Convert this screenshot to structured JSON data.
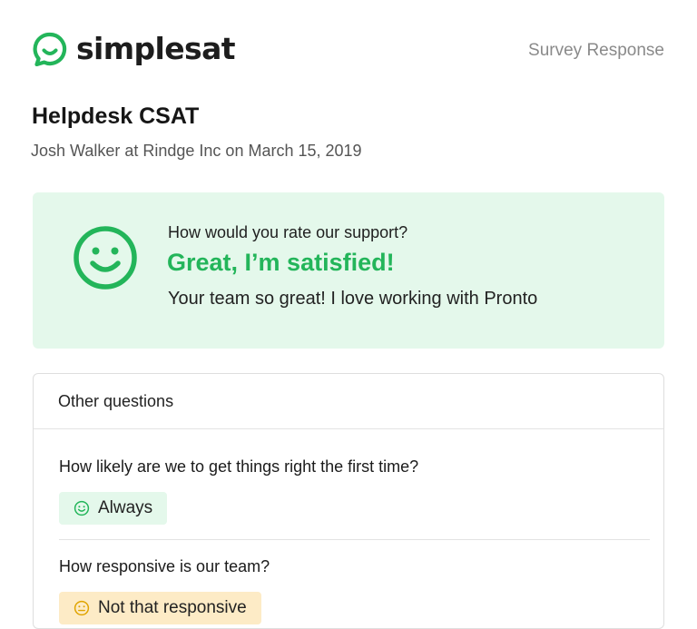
{
  "header": {
    "brand": "simplesat",
    "right_label": "Survey Response"
  },
  "survey": {
    "title": "Helpdesk CSAT",
    "meta": "Josh Walker at Rindge Inc on March 15, 2019"
  },
  "rating": {
    "question": "How would you rate our support?",
    "answer": "Great, I’m satisfied!",
    "comment": "Your team so great! I love working with Pronto"
  },
  "other": {
    "title": "Other questions",
    "items": [
      {
        "question": "How likely are we to get things right the first time?",
        "answer": "Always"
      },
      {
        "question": "How responsive is our team?",
        "answer": "Not that responsive"
      }
    ]
  },
  "colors": {
    "brand_green": "#23b55a",
    "positive_bg": "#e4f8eb",
    "neutral_bg": "#fdebc6",
    "neutral_icon": "#e0a400"
  }
}
